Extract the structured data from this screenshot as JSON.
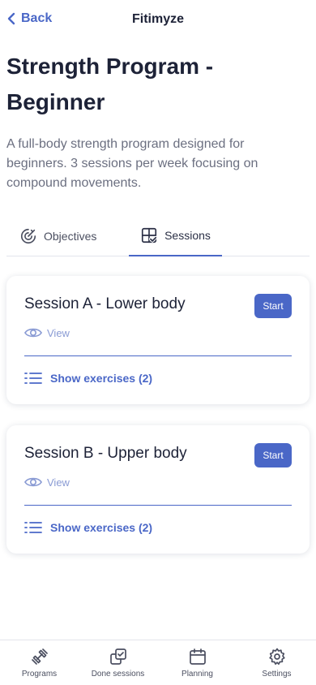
{
  "header": {
    "back_label": "Back",
    "app_title": "Fitimyze"
  },
  "program": {
    "title": "Strength Program - Beginner",
    "description": "A full-body strength program designed for beginners. 3 sessions per week focusing on compound movements."
  },
  "tabs": [
    {
      "label": "Objectives",
      "icon": "target-icon",
      "active": false
    },
    {
      "label": "Sessions",
      "icon": "grid-check-icon",
      "active": true
    }
  ],
  "sessions": [
    {
      "title": "Session A - Lower body",
      "start_label": "Start",
      "view_label": "View",
      "exercises_label": "Show exercises (2)"
    },
    {
      "title": "Session B - Upper body",
      "start_label": "Start",
      "view_label": "View",
      "exercises_label": "Show exercises (2)"
    }
  ],
  "bottom_nav": [
    {
      "label": "Programs",
      "icon": "dumbbell-icon"
    },
    {
      "label": "Done sessions",
      "icon": "copy-check-icon"
    },
    {
      "label": "Planning",
      "icon": "calendar-icon"
    },
    {
      "label": "Settings",
      "icon": "gear-icon"
    }
  ],
  "colors": {
    "accent": "#4a67c7",
    "text": "#1d2237",
    "muted": "#6b6f80",
    "view": "#8a9bd4"
  }
}
